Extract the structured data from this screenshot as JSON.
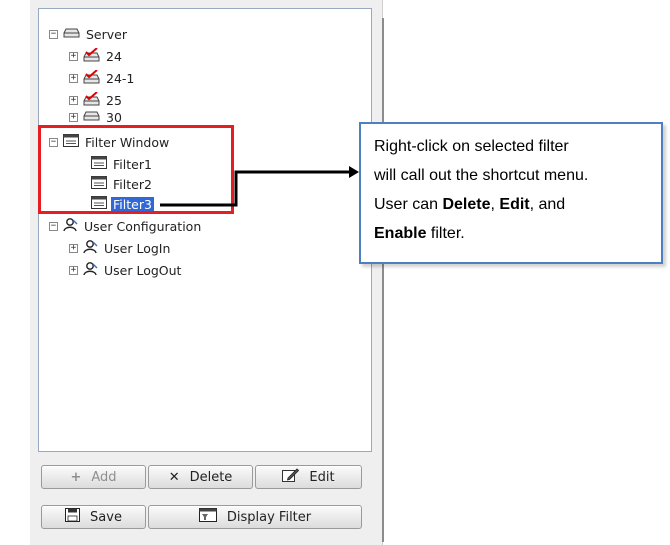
{
  "tree": {
    "server": {
      "label": "Server",
      "toggle": "−",
      "icon": "server-icon"
    },
    "servers": [
      {
        "label": "24",
        "toggle": "+",
        "icon": "server-checked-icon"
      },
      {
        "label": "24-1",
        "toggle": "+",
        "icon": "server-checked-icon"
      },
      {
        "label": "25",
        "toggle": "+",
        "icon": "server-checked-icon"
      },
      {
        "label": "30",
        "toggle": "+",
        "icon": "server-icon"
      }
    ],
    "filter_window": {
      "label": "Filter Window",
      "toggle": "−",
      "icon": "window-icon"
    },
    "filters": [
      {
        "label": "Filter1",
        "icon": "filter-icon"
      },
      {
        "label": "Filter2",
        "icon": "filter-icon"
      },
      {
        "label": "Filter3",
        "icon": "filter-icon",
        "selected": true
      }
    ],
    "user_configuration": {
      "label": "User Configuration",
      "toggle": "−",
      "icon": "users-icon"
    },
    "user_items": [
      {
        "label": "User LogIn",
        "toggle": "+",
        "icon": "user-icon"
      },
      {
        "label": "User LogOut",
        "toggle": "+",
        "icon": "user-icon"
      }
    ]
  },
  "buttons": {
    "add": {
      "label": "Add",
      "icon": "+",
      "enabled": false
    },
    "delete": {
      "label": "Delete",
      "icon": "✕",
      "enabled": true
    },
    "edit": {
      "label": "Edit",
      "icon": "edit-icon",
      "enabled": true
    },
    "save": {
      "label": "Save",
      "icon": "save-icon",
      "enabled": true
    },
    "display_filter": {
      "label": "Display Filter",
      "icon": "display-filter-icon",
      "enabled": true
    }
  },
  "callout": {
    "line1": "Right-click on selected filter",
    "line2": "will call out the shortcut menu.",
    "line3_prefix": "User can ",
    "delete_word": "Delete",
    "sep1": ", ",
    "edit_word": "Edit",
    "sep2": ", and",
    "enable_word": "Enable",
    "line4_suffix": " filter."
  },
  "colors": {
    "selection": "#3168d5",
    "highlight_box": "#e51e22",
    "callout_border": "#4e7fbf"
  }
}
